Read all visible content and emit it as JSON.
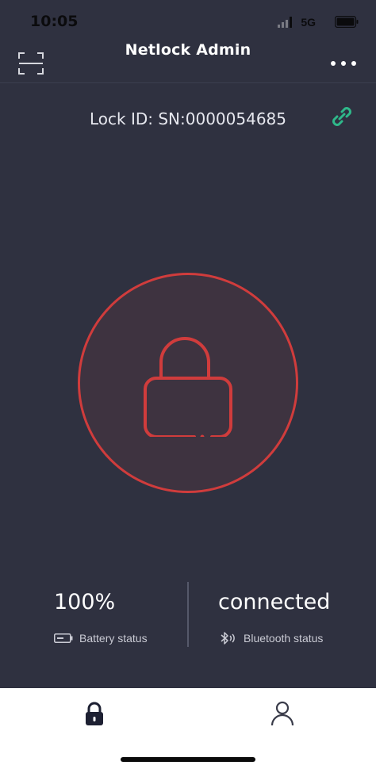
{
  "status_bar": {
    "time": "10:05",
    "network": "5G"
  },
  "header": {
    "title": "Netlock Admin"
  },
  "lock": {
    "id_text": "Lock ID: SN:0000054685",
    "state": "locked",
    "accent_color": "#d03c3c"
  },
  "stats": {
    "battery": {
      "value": "100%",
      "label": "Battery status"
    },
    "bluetooth": {
      "value": "connected",
      "label": "Bluetooth status"
    }
  },
  "icons": {
    "scan": "scan-icon",
    "more": "more-dots-icon",
    "link": "link-icon",
    "lock": "padlock-icon",
    "battery": "battery-icon",
    "bluetooth": "bluetooth-icon",
    "tab_lock": "lock-tab-icon",
    "tab_profile": "person-icon"
  },
  "colors": {
    "background": "#2f3140",
    "link": "#2fb88a",
    "tab_bar": "#ffffff"
  }
}
